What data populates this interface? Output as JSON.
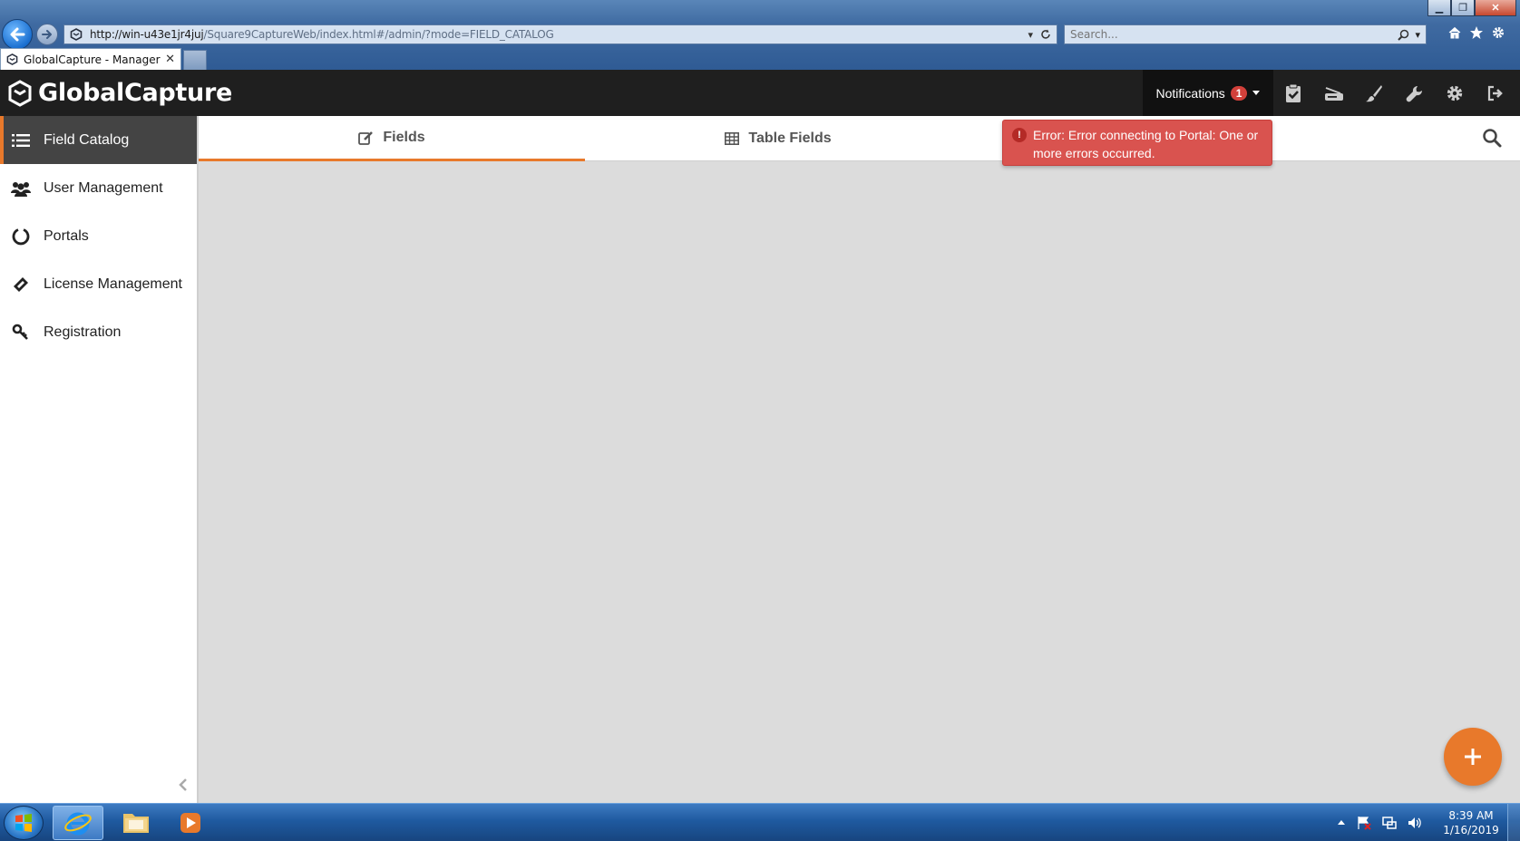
{
  "browser": {
    "url_domain": "http://win-u43e1jr4juj",
    "url_path": "/Square9CaptureWeb/index.html#/admin/?mode=FIELD_CATALOG",
    "search_placeholder": "Search...",
    "tab_title": "GlobalCapture - Manager",
    "tab_close": "✕"
  },
  "header": {
    "brand": "GlobalCapture",
    "notifications_label": "Notifications",
    "notifications_count": "1"
  },
  "sidebar": {
    "items": [
      {
        "label": "Field Catalog",
        "icon": "list-icon",
        "active": true
      },
      {
        "label": "User Management",
        "icon": "users-icon",
        "active": false
      },
      {
        "label": "Portals",
        "icon": "circle-notch-icon",
        "active": false
      },
      {
        "label": "License Management",
        "icon": "ticket-icon",
        "active": false
      },
      {
        "label": "Registration",
        "icon": "key-icon",
        "active": false
      }
    ]
  },
  "tabs": {
    "fields": "Fields",
    "table_fields": "Table Fields"
  },
  "toast": {
    "message": "Error: Error connecting to Portal: One or more errors occurred."
  },
  "taskbar": {
    "time": "8:39 AM",
    "date": "1/16/2019"
  },
  "colors": {
    "accent": "#e8792b",
    "header_bg": "#1f1f1f",
    "error": "#d9534f"
  }
}
